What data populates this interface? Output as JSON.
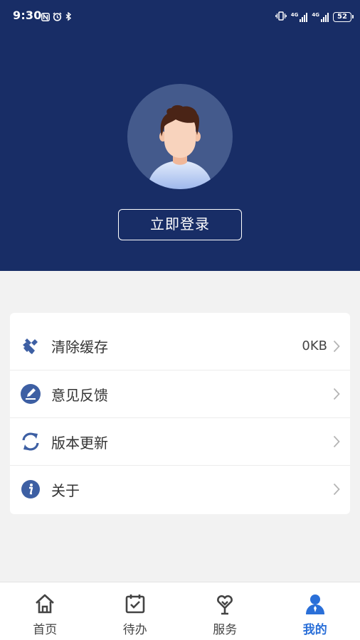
{
  "status_bar": {
    "time": "9:30",
    "left_icons": [
      "nfc-icon",
      "alarm-icon",
      "bluetooth-icon"
    ],
    "right_icons": [
      "vibrate-icon",
      "signal-4g-icon",
      "signal-4g-icon"
    ],
    "network_labels": [
      "4G",
      "4G"
    ],
    "battery": "52"
  },
  "header": {
    "background": "#182d66",
    "avatar_icon": "user-avatar-icon",
    "login_label": "立即登录"
  },
  "menu": {
    "items": [
      {
        "icon": "broom-icon",
        "label": "清除缓存",
        "value": "0KB"
      },
      {
        "icon": "edit-icon",
        "label": "意见反馈",
        "value": ""
      },
      {
        "icon": "refresh-icon",
        "label": "版本更新",
        "value": ""
      },
      {
        "icon": "info-icon",
        "label": "关于",
        "value": ""
      }
    ],
    "icon_color": "#3d5fa3"
  },
  "bottom_nav": {
    "tabs": [
      {
        "icon": "home-icon",
        "label": "首页",
        "active": false
      },
      {
        "icon": "calendar-check-icon",
        "label": "待办",
        "active": false
      },
      {
        "icon": "heart-service-icon",
        "label": "服务",
        "active": false
      },
      {
        "icon": "person-icon",
        "label": "我的",
        "active": true
      }
    ],
    "active_color": "#2a6fd8"
  }
}
